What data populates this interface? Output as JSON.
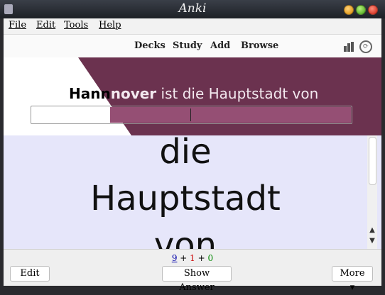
{
  "window": {
    "title": "Anki"
  },
  "menubar": {
    "file": "File",
    "edit": "Edit",
    "tools": "Tools",
    "help": "Help"
  },
  "toolbar": {
    "decks": "Decks",
    "study": "Study",
    "add": "Add",
    "browse": "Browse"
  },
  "icons": {
    "stats": "stats-bars-icon",
    "sync": "sync-icon"
  },
  "card": {
    "question_part1": "Hann",
    "question_part2": "nover",
    "question_part3": " ist die Hauptstadt von",
    "answer_value": "",
    "body_lines": [
      "die",
      "Hauptstadt",
      "von"
    ]
  },
  "counts": {
    "new": "9",
    "learning": "1",
    "review": "0",
    "plus": "+"
  },
  "buttons": {
    "edit": "Edit",
    "show_answer": "Show Answer",
    "more": "More ▾"
  },
  "colors": {
    "overlay": "#6b324f",
    "background": "#e6e6fa",
    "new": "#0000aa",
    "learning": "#cc0000",
    "review": "#008800"
  }
}
